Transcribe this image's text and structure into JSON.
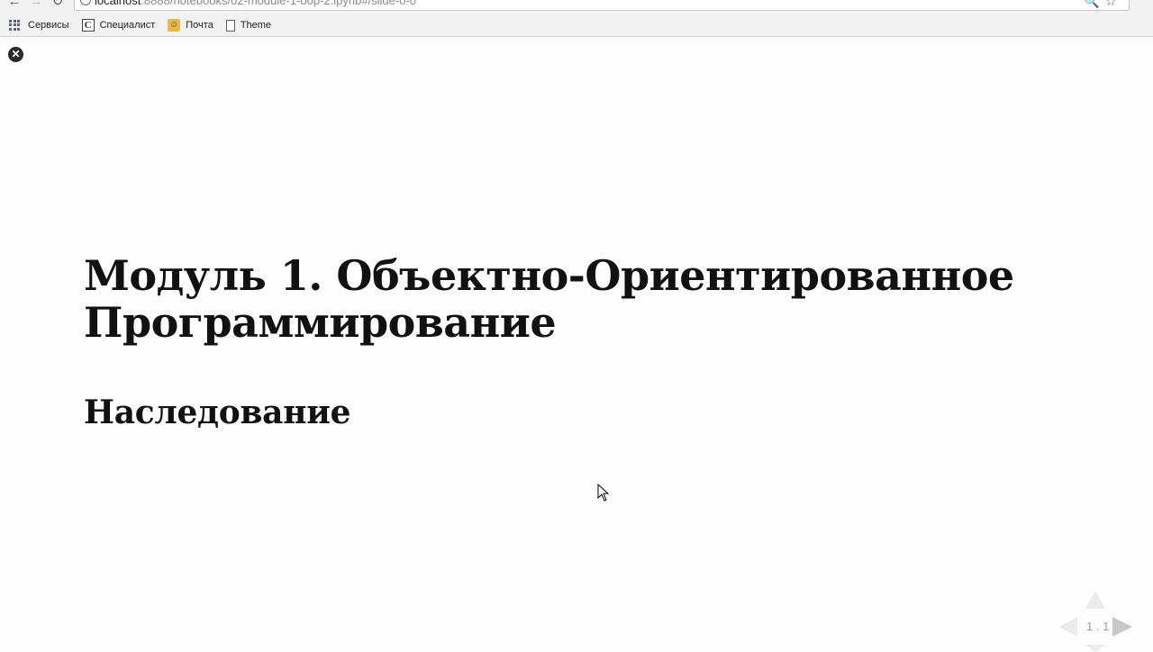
{
  "browser": {
    "url_host": "localhost",
    "url_rest": ":8888/notebooks/02-module-1-oop-2.ipynb#/slide-0-0",
    "bookmarks": [
      {
        "label": "Сервисы",
        "icon": "apps-icon"
      },
      {
        "label": "Специалист",
        "icon": "specialist-c-icon"
      },
      {
        "label": "Почта",
        "icon": "mail-icon"
      },
      {
        "label": "Theme",
        "icon": "page-icon"
      }
    ]
  },
  "slide": {
    "title": "Модуль 1. Объектно-Ориентированное Программирование",
    "subtitle": "Наследование",
    "slide_number": "1 . 1"
  }
}
